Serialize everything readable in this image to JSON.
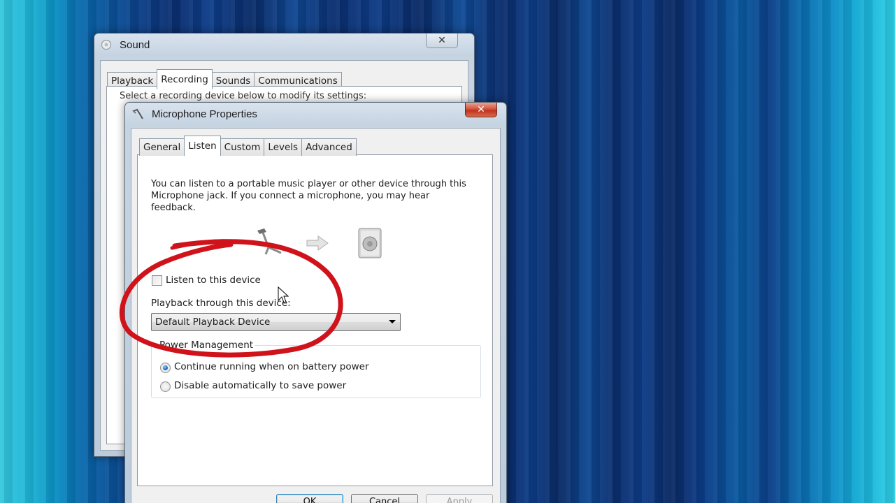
{
  "sound_window": {
    "title": "Sound",
    "tabs": [
      "Playback",
      "Recording",
      "Sounds",
      "Communications"
    ],
    "active_tab": "Recording",
    "partial_text": "Select a recording device below to modify its settings:"
  },
  "mic_window": {
    "title": "Microphone Properties",
    "tabs": [
      "General",
      "Listen",
      "Custom",
      "Levels",
      "Advanced"
    ],
    "active_tab": "Listen",
    "description": "You can listen to a portable music player or other device through this Microphone jack.  If you connect a microphone, you may hear feedback.",
    "listen_checkbox_label": "Listen to this device",
    "listen_checked": false,
    "playback_label": "Playback through this device:",
    "playback_value": "Default Playback Device",
    "power_group_title": "Power Management",
    "power_options": [
      "Continue running when on battery power",
      "Disable automatically to save power"
    ],
    "power_selected": 0,
    "buttons": {
      "ok": "OK",
      "cancel": "Cancel",
      "apply": "Apply"
    }
  },
  "icons": [
    "sound-icon",
    "microphone-icon",
    "arrow-right-icon",
    "speaker-icon",
    "close-icon",
    "cursor-icon"
  ],
  "colors": {
    "annotation": "#d0121b",
    "close_button": "#c0321c",
    "radio_selected": "#1b6fd0"
  }
}
